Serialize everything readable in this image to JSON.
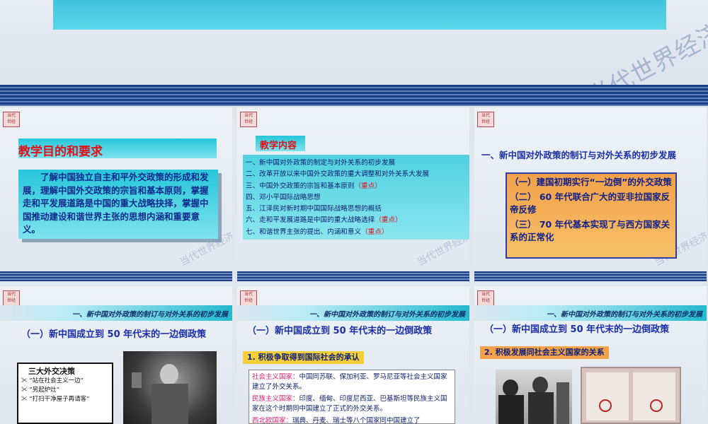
{
  "banner": {
    "watermark": "当代世界经济与政治"
  },
  "slide1": {
    "title": "教学目的和要求",
    "body": "了解中国独立自主和平外交政策的形成和发展，理解中国外交政策的宗旨和基本原则，掌握走和平发展道路是中国的重大战略抉择，掌握中国推动建设和谐世界主张的思想内涵和重要意义。"
  },
  "slide2": {
    "title": "教学内容",
    "items": [
      {
        "text": "一、新中国对外政策的制定与对外关系的初步发展",
        "note": ""
      },
      {
        "text": "二、改革开放以来中国外交政策的重大调整和对外关系大发展",
        "note": ""
      },
      {
        "text": "三、中国外交政策的宗旨和基本原则",
        "note": "（重点）"
      },
      {
        "text": "四、邓小平国际战略思想",
        "note": ""
      },
      {
        "text": "五、江泽民对新时期中国国际战略思想的概括",
        "note": ""
      },
      {
        "text": "六、走和平发展道路是中国的重大战略选择",
        "note": "（重点）"
      },
      {
        "text": "七、和谐世界主张的提出、内涵和意义",
        "note": "（重点）"
      }
    ]
  },
  "slide3": {
    "title": "一、新中国对外政策的制订与对外关系的初步发展",
    "points": [
      "（一）建国初期实行“一边倒”的外交政策",
      "（二） 60 年代联合广大的亚非拉国家反帝反修",
      "（三） 70 年代基本实现了与西方国家关系的正常化"
    ]
  },
  "slide4": {
    "header": "一、新中国对外政策的制订与对外关系的初步发展",
    "subtitle": "（一）新中国成立到 50 年代末的一边倒政策",
    "box_title": "三大外交决策",
    "box_items": [
      "“站在社会主义一边”",
      "“另起炉灶”",
      "“打扫干净屋子再请客”"
    ]
  },
  "slide5": {
    "header": "一、新中国对外政策的制订与对外关系的初步发展",
    "subtitle": "（一）新中国成立到 50 年代末的一边倒政策",
    "label": "1. 积极争取得到国际社会的承认",
    "p1_head": "社会主义国家：",
    "p1_body": "中国同苏联、保加利亚、罗马尼亚等社会主义国家建立了外交关系。",
    "p2_head": "民族主义国家：",
    "p2_body": "印度、缅甸、印度尼西亚、巴基斯坦等民族主义国家在这个时期同中国建立了正式的外交关系。",
    "p3_head": "西北欧国家：",
    "p3_body": "瑞典、丹麦、瑞士等八个国家同中国建立了"
  },
  "slide6": {
    "header": "一、新中国对外政策的制订与对外关系的初步发展",
    "subtitle": "（一）新中国成立到 50 年代末的一边倒政策",
    "label": "2. 积极发展同社会主义国家的关系"
  }
}
